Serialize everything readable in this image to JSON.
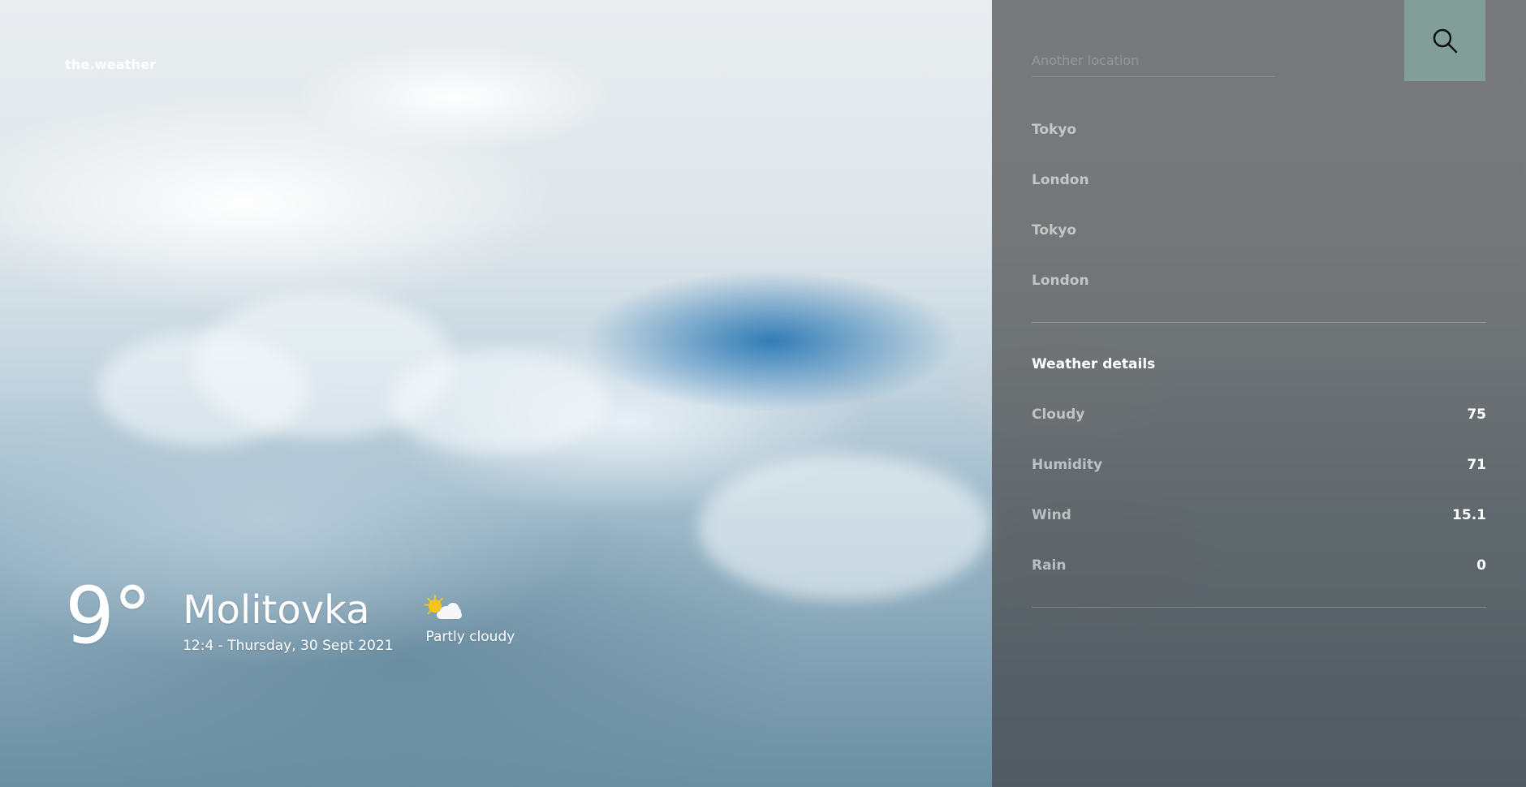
{
  "app": {
    "brand": "the.weather"
  },
  "current": {
    "temperature": "9°",
    "city": "Molitovka",
    "datetime": "12:4 - Thursday, 30 Sept 2021",
    "condition": "Partly cloudy",
    "icon": "partly-cloudy-icon"
  },
  "search": {
    "placeholder": "Another location",
    "button_icon": "search-icon",
    "button_color": "#819f98"
  },
  "locations": [
    {
      "label": "Tokyo"
    },
    {
      "label": "London"
    },
    {
      "label": "Tokyo"
    },
    {
      "label": "London"
    }
  ],
  "details": {
    "title": "Weather details",
    "rows": [
      {
        "label": "Cloudy",
        "value": "75"
      },
      {
        "label": "Humidity",
        "value": "71"
      },
      {
        "label": "Wind",
        "value": "15.1"
      },
      {
        "label": "Rain",
        "value": "0"
      }
    ]
  }
}
